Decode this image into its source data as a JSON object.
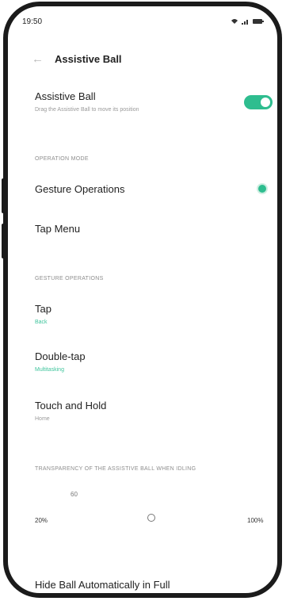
{
  "status_bar": {
    "time": "19:50"
  },
  "header": {
    "title": "Assistive Ball"
  },
  "assistive_ball": {
    "title": "Assistive Ball",
    "subtitle": "Drag the Assistive Ball to move its position",
    "enabled": true
  },
  "operation_mode": {
    "section_label": "OPERATION MODE",
    "options": [
      {
        "label": "Gesture Operations",
        "selected": true
      },
      {
        "label": "Tap Menu",
        "selected": false
      }
    ]
  },
  "gesture_operations": {
    "section_label": "GESTURE OPERATIONS",
    "items": [
      {
        "label": "Tap",
        "value": "Back"
      },
      {
        "label": "Double-tap",
        "value": "Multitasking"
      },
      {
        "label": "Touch and Hold",
        "value": "Home"
      }
    ]
  },
  "transparency": {
    "section_label": "TRANSPARENCY OF THE ASSISTIVE BALL WHEN IDLING",
    "current": "60",
    "min_label": "20%",
    "max_label": "100%",
    "value_percent": 60
  },
  "hide_ball": {
    "label": "Hide Ball Automatically in Full"
  },
  "colors": {
    "accent": "#2ebd8f"
  }
}
